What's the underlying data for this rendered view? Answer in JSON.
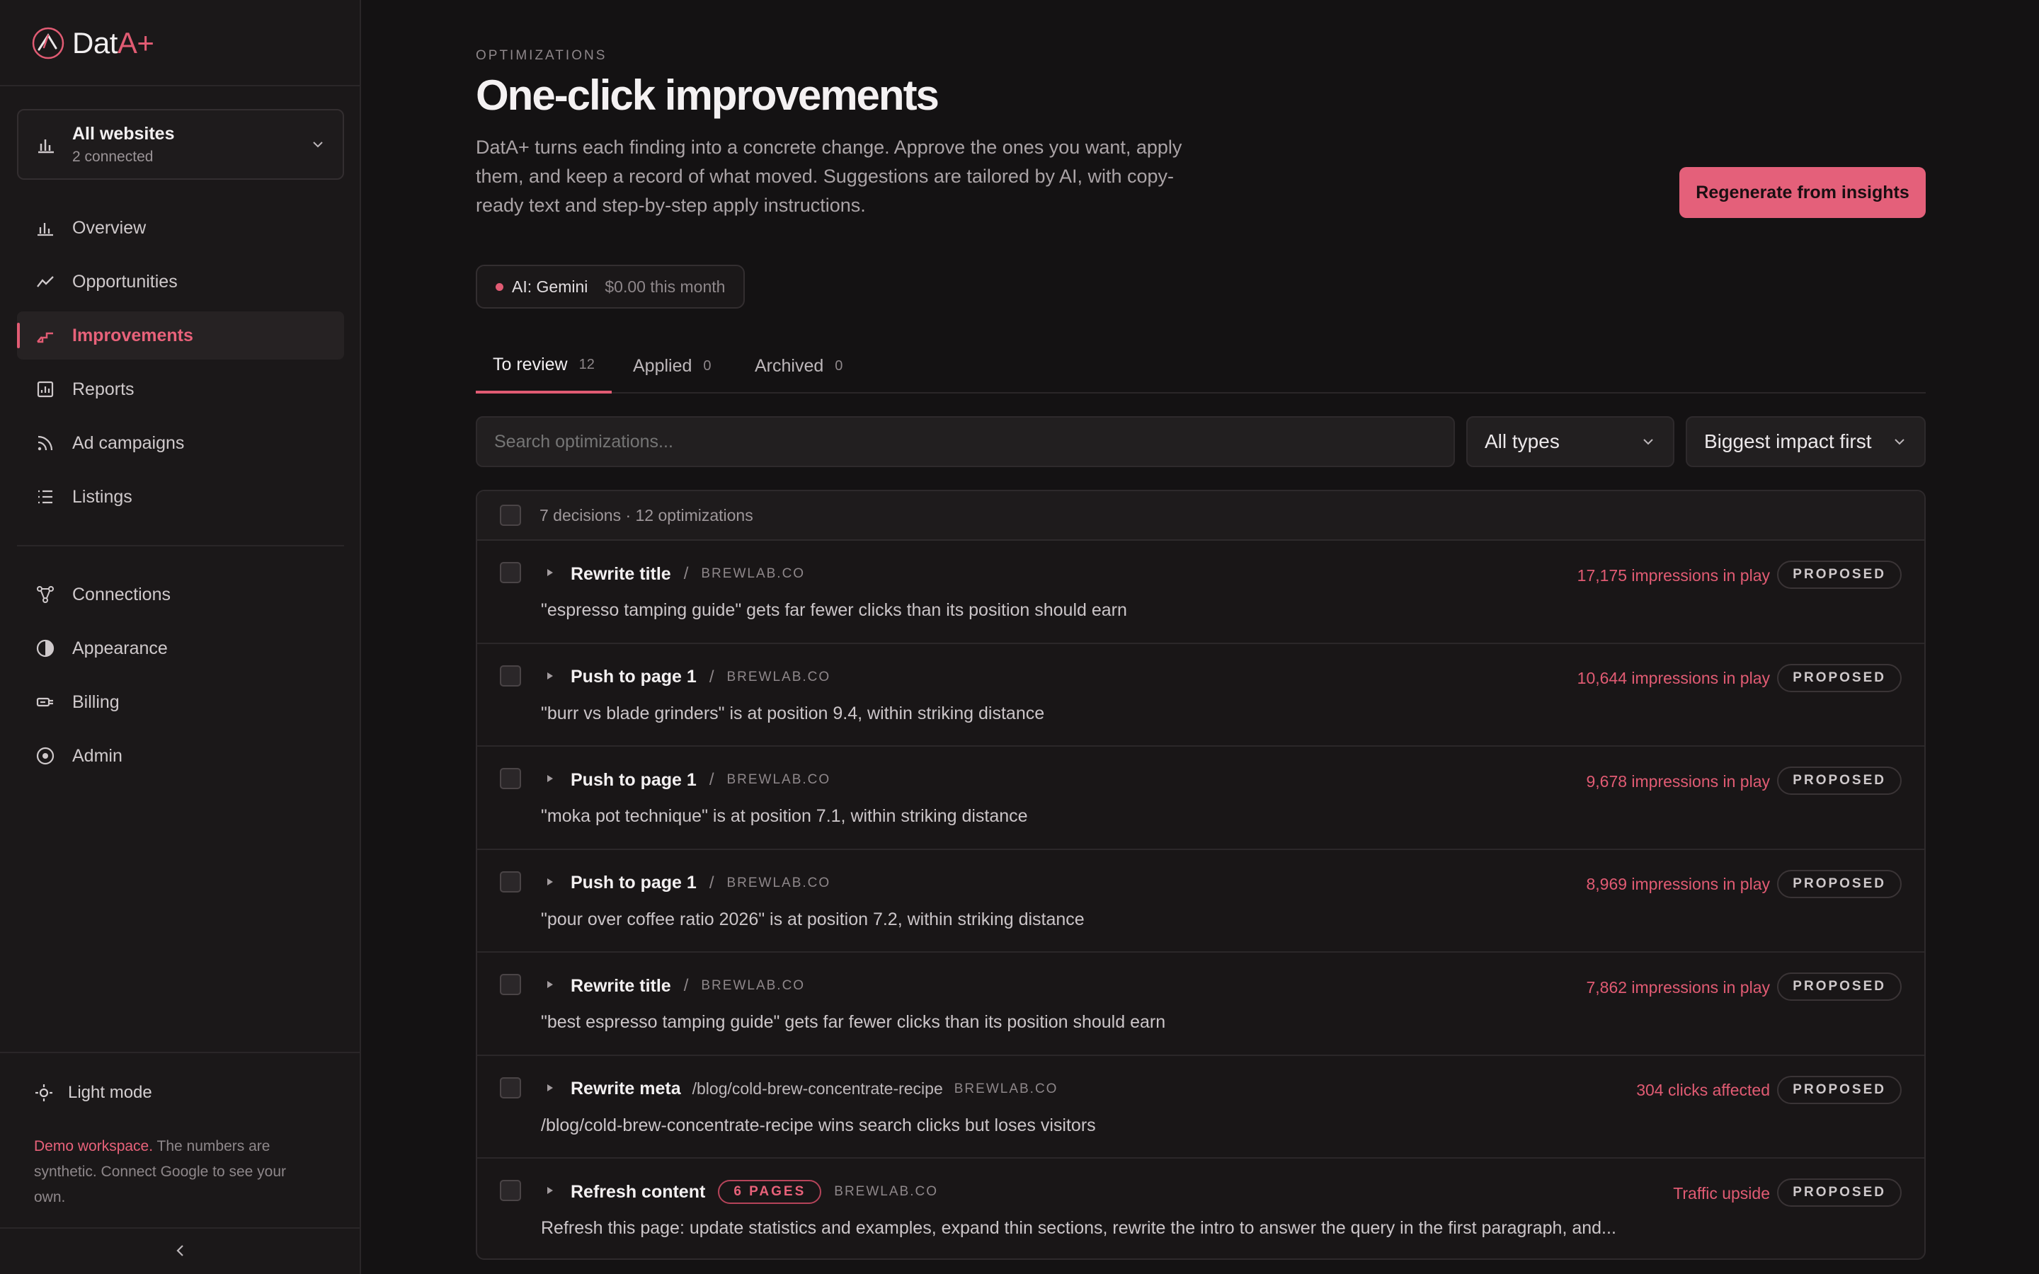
{
  "brand": {
    "name_main": "Dat",
    "name_accent": "A+"
  },
  "site_switcher": {
    "title": "All websites",
    "subtitle": "2 connected"
  },
  "nav": {
    "primary": [
      {
        "label": "Overview",
        "icon": "bar-chart-icon"
      },
      {
        "label": "Opportunities",
        "icon": "trend-line-icon"
      },
      {
        "label": "Improvements",
        "icon": "steps-icon",
        "active": true
      },
      {
        "label": "Reports",
        "icon": "report-icon"
      },
      {
        "label": "Ad campaigns",
        "icon": "rss-icon"
      },
      {
        "label": "Listings",
        "icon": "list-icon"
      }
    ],
    "secondary": [
      {
        "label": "Connections",
        "icon": "nodes-icon"
      },
      {
        "label": "Appearance",
        "icon": "contrast-icon"
      },
      {
        "label": "Billing",
        "icon": "billing-icon"
      },
      {
        "label": "Admin",
        "icon": "target-icon"
      }
    ]
  },
  "sidebar_footer": {
    "light_mode": "Light mode",
    "demo_highlight": "Demo workspace.",
    "demo_text": " The numbers are synthetic. Connect Google to see your own."
  },
  "header": {
    "eyebrow": "OPTIMIZATIONS",
    "title": "One-click improvements",
    "description": "DatA+ turns each finding into a concrete change. Approve the ones you want, apply them, and keep a record of what moved. Suggestions are tailored by AI, with copy-ready text and step-by-step apply instructions.",
    "regenerate_label": "Regenerate from insights"
  },
  "ai_pill": {
    "name": "AI: Gemini",
    "cost": "$0.00 this month"
  },
  "tabs": [
    {
      "label": "To review",
      "count": "12",
      "active": true
    },
    {
      "label": "Applied",
      "count": "0"
    },
    {
      "label": "Archived",
      "count": "0"
    }
  ],
  "filters": {
    "search_placeholder": "Search optimizations...",
    "type_select": "All types",
    "sort_select": "Biggest impact first"
  },
  "list_header": "7 decisions · 12 optimizations",
  "rows": [
    {
      "title": "Rewrite title",
      "domain": "BREWLAB.CO",
      "desc": "\"espresso tamping guide\" gets far fewer clicks than its position should earn",
      "impact": "17,175 impressions in play",
      "status": "PROPOSED"
    },
    {
      "title": "Push to page 1",
      "domain": "BREWLAB.CO",
      "desc": "\"burr vs blade grinders\" is at position 9.4, within striking distance",
      "impact": "10,644 impressions in play",
      "status": "PROPOSED"
    },
    {
      "title": "Push to page 1",
      "domain": "BREWLAB.CO",
      "desc": "\"moka pot technique\" is at position 7.1, within striking distance",
      "impact": "9,678 impressions in play",
      "status": "PROPOSED"
    },
    {
      "title": "Push to page 1",
      "domain": "BREWLAB.CO",
      "desc": "\"pour over coffee ratio 2026\" is at position 7.2, within striking distance",
      "impact": "8,969 impressions in play",
      "status": "PROPOSED"
    },
    {
      "title": "Rewrite title",
      "domain": "BREWLAB.CO",
      "desc": "\"best espresso tamping guide\" gets far fewer clicks than its position should earn",
      "impact": "7,862 impressions in play",
      "status": "PROPOSED"
    },
    {
      "title": "Rewrite meta",
      "path": "/blog/cold-brew-concentrate-recipe",
      "domain": "BREWLAB.CO",
      "desc": "/blog/cold-brew-concentrate-recipe wins search clicks but loses visitors",
      "impact": "304 clicks affected",
      "status": "PROPOSED"
    },
    {
      "title": "Refresh content",
      "badge": "6 PAGES",
      "domain": "BREWLAB.CO",
      "desc": "Refresh this page: update statistics and examples, expand thin sections, rewrite the intro to answer the query in the first paragraph, and...",
      "impact": "Traffic upside",
      "status": "PROPOSED"
    }
  ],
  "colors": {
    "accent": "#e15b73",
    "background": "#141213",
    "sidebar": "#1b1819"
  }
}
